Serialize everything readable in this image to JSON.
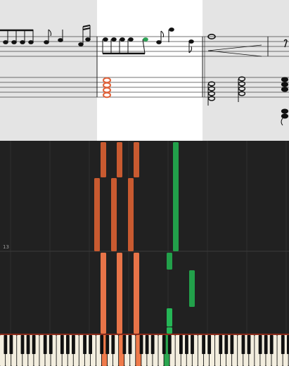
{
  "score": {
    "measures": [
      {
        "id": "prev",
        "state": "past"
      },
      {
        "id": "current",
        "state": "playing"
      },
      {
        "id": "next",
        "state": "upcoming"
      }
    ],
    "colors": {
      "background": "#e4e4e4",
      "current_background": "#ffffff",
      "ink": "#111111",
      "active_chord": "#e0623a",
      "active_note": "#2aa052"
    }
  },
  "roll": {
    "measure_number": "13",
    "colors": {
      "background": "#212121",
      "grid": "#2e2e2e",
      "left_hand": "#e87448",
      "left_hand_dim": "#c85a30",
      "right_hand": "#22a04a",
      "right_hand_bright": "#25b656",
      "beat_line": "#b8612f"
    }
  },
  "keyboard": {
    "colors": {
      "white_key": "#f3eedf",
      "black_key": "#111111",
      "pressed_left": "#ef7a4a",
      "pressed_right": "#2aa64e",
      "top_rail": "#8a2a1a"
    }
  }
}
